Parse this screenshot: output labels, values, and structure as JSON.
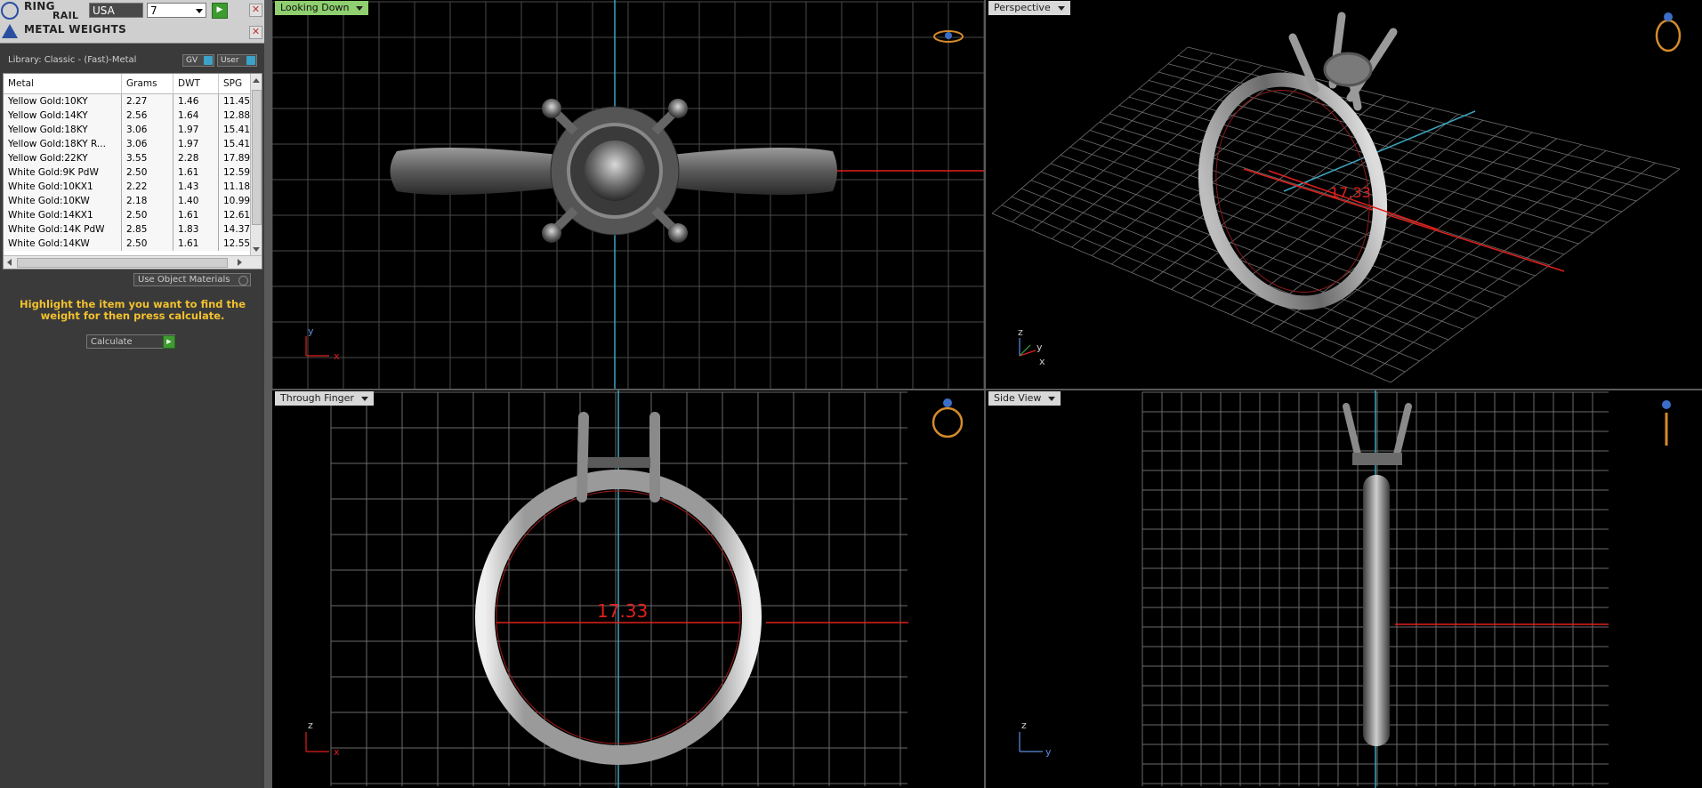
{
  "ring_rail": {
    "title_line1": "RING",
    "title_line2": "RAIL",
    "country": "USA",
    "size": "7"
  },
  "metal_weights": {
    "title": "METAL WEIGHTS",
    "library": "Library: Classic - (Fast)-Metal",
    "btn_gv": "GV",
    "btn_user": "User",
    "columns": [
      "Metal",
      "Grams",
      "DWT",
      "SPG"
    ],
    "rows": [
      [
        "Yellow Gold:10KY",
        "2.27",
        "1.46",
        "11.45"
      ],
      [
        "Yellow Gold:14KY",
        "2.56",
        "1.64",
        "12.88"
      ],
      [
        "Yellow Gold:18KY",
        "3.06",
        "1.97",
        "15.41"
      ],
      [
        "Yellow Gold:18KY R...",
        "3.06",
        "1.97",
        "15.41"
      ],
      [
        "Yellow Gold:22KY",
        "3.55",
        "2.28",
        "17.89"
      ],
      [
        "White Gold:9K PdW",
        "2.50",
        "1.61",
        "12.59"
      ],
      [
        "White Gold:10KX1",
        "2.22",
        "1.43",
        "11.18"
      ],
      [
        "White Gold:10KW",
        "2.18",
        "1.40",
        "10.99"
      ],
      [
        "White Gold:14KX1",
        "2.50",
        "1.61",
        "12.61"
      ],
      [
        "White Gold:14K PdW",
        "2.85",
        "1.83",
        "14.37"
      ],
      [
        "White Gold:14KW",
        "2.50",
        "1.61",
        "12.55"
      ]
    ],
    "use_object_materials": "Use Object Materials",
    "hint": "Highlight the item you want to find the weight for then press calculate.",
    "calculate": "Calculate"
  },
  "viewports": {
    "top_left": {
      "label": "Looking Down",
      "axis_v": "y",
      "axis_h": "x"
    },
    "top_right": {
      "label": "Perspective",
      "axis_v": "z",
      "axis_h": "x",
      "axis_d": "y",
      "dimension": "17.33"
    },
    "bottom_left": {
      "label": "Through Finger",
      "axis_v": "z",
      "axis_h": "x",
      "dimension": "17.33"
    },
    "bottom_right": {
      "label": "Side View",
      "axis_v": "z",
      "axis_h": "y"
    }
  },
  "colors": {
    "active_label": "#8fcf6f",
    "hint_text": "#f2c12e",
    "dimension": "#e0201c",
    "axis_blue": "#3aa6c0"
  }
}
